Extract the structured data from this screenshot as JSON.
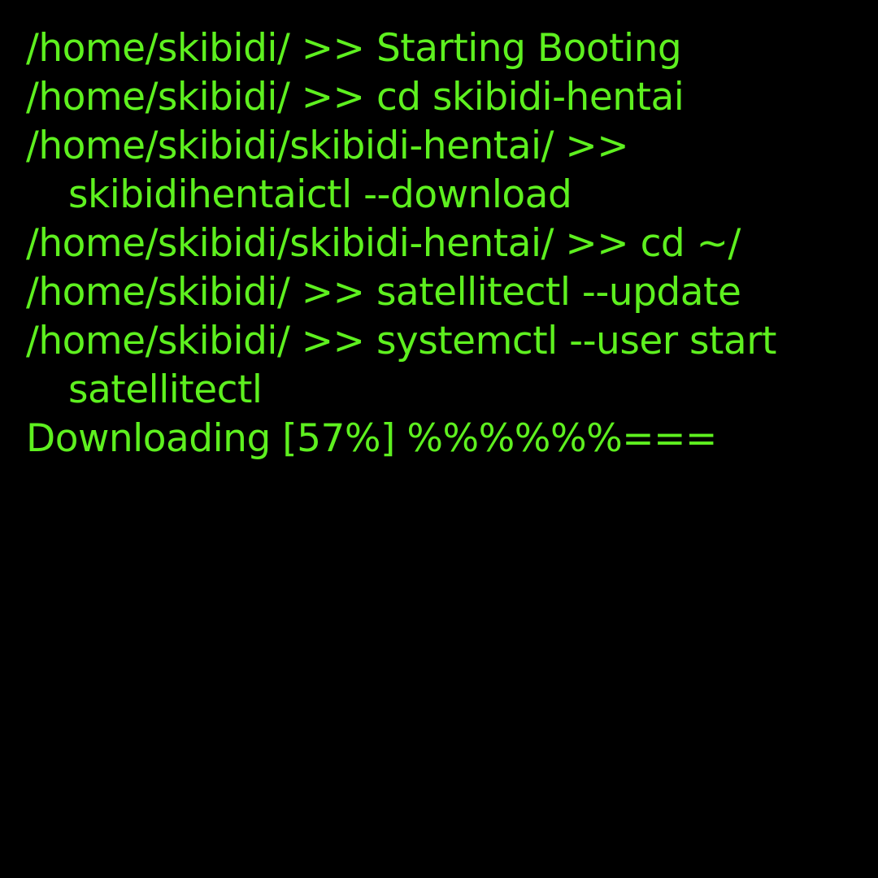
{
  "terminal": {
    "colors": {
      "background": "#000000",
      "foreground": "#5ef01f"
    },
    "lines": [
      {
        "prompt": "/home/skibidi/ >> ",
        "command": "Starting Booting"
      },
      {
        "prompt": "/home/skibidi/ >> ",
        "command": "cd skibidi-hentai"
      },
      {
        "prompt": "/home/skibidi/skibidi-hentai/ >>",
        "command_continued": "skibidihentaictl --download"
      },
      {
        "prompt": "/home/skibidi/skibidi-hentai/ >> ",
        "command": "cd ~/"
      },
      {
        "prompt": "/home/skibidi/ >> ",
        "command": "satellitectl --update"
      },
      {
        "prompt": "/home/skibidi/ >> ",
        "command": "systemctl --user start",
        "command_continued": "satellitectl"
      }
    ],
    "progress": {
      "text": "Downloading [57%] %%%%%%===",
      "percent": 57
    }
  }
}
